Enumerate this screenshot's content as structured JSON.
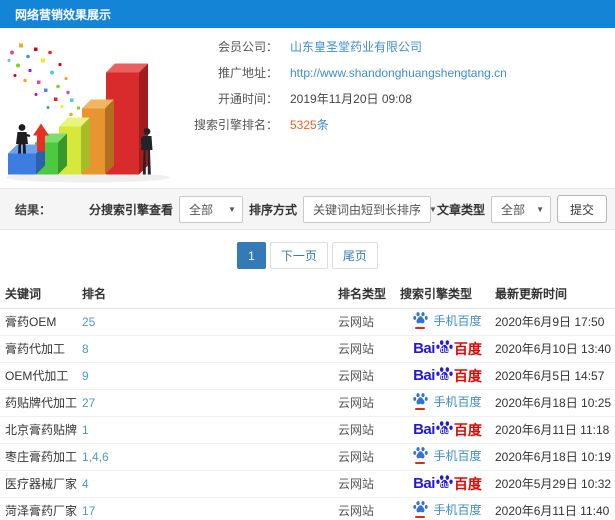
{
  "header": {
    "title": "网络营销效果展示"
  },
  "info": {
    "company_label": "会员公司：",
    "company_value": "山东皇圣堂药业有限公司",
    "url_label": "推广地址：",
    "url_value": "http://www.shandonghuangshengtang.cn",
    "open_label": "开通时间：",
    "open_value": "2019年11月20日 09:08",
    "rank_label": "搜索引擎排名：",
    "rank_count": "5325",
    "rank_unit": "条"
  },
  "filters": {
    "result_label": "结果：",
    "engine_label": "分搜索引擎查看",
    "engine_value": "全部",
    "sort_label": "排序方式",
    "sort_value": "关键词由短到长排序",
    "article_label": "文章类型",
    "article_value": "全部",
    "submit_label": "提交",
    "caret": "▼"
  },
  "pagination": {
    "current": "1",
    "next": "下一页",
    "last": "尾页"
  },
  "engines": {
    "mobile_label": "手机百度",
    "baidu_bai": "Bai",
    "baidu_du": "du",
    "baidu_cn": "百度"
  },
  "table": {
    "headers": [
      "关键词",
      "排名",
      "排名类型",
      "搜索引擎类型",
      "最新更新时间"
    ],
    "rows": [
      {
        "keyword": "膏药OEM",
        "rank": "25",
        "rank_type": "云网站",
        "engine": "手机百度",
        "time": "2020年6月9日 17:50"
      },
      {
        "keyword": "膏药代加工",
        "rank": "8",
        "rank_type": "云网站",
        "engine": "百度",
        "time": "2020年6月10日 13:40"
      },
      {
        "keyword": "OEM代加工",
        "rank": "9",
        "rank_type": "云网站",
        "engine": "百度",
        "time": "2020年6月5日 14:57"
      },
      {
        "keyword": "药贴牌代加工",
        "rank": "27",
        "rank_type": "云网站",
        "engine": "手机百度",
        "time": "2020年6月18日 10:25"
      },
      {
        "keyword": "北京膏药贴牌",
        "rank": "1",
        "rank_type": "云网站",
        "engine": "百度",
        "time": "2020年6月11日 11:18"
      },
      {
        "keyword": "枣庄膏药加工",
        "rank": "1,4,6",
        "rank_type": "云网站",
        "engine": "手机百度",
        "time": "2020年6月18日 10:19"
      },
      {
        "keyword": "医疗器械厂家",
        "rank": "4",
        "rank_type": "云网站",
        "engine": "百度",
        "time": "2020年5月29日 10:32"
      },
      {
        "keyword": "菏泽膏药厂家",
        "rank": "17",
        "rank_type": "云网站",
        "engine": "手机百度",
        "time": "2020年6月11日 11:40"
      }
    ]
  },
  "colors": {
    "header_bg": "#1484d6",
    "link_blue": "#3e8ed0",
    "highlight_orange": "#ff5a1e",
    "baidu_blue": "#2319dc",
    "baidu_red": "#e10601",
    "pagination_active": "#337ab7"
  }
}
